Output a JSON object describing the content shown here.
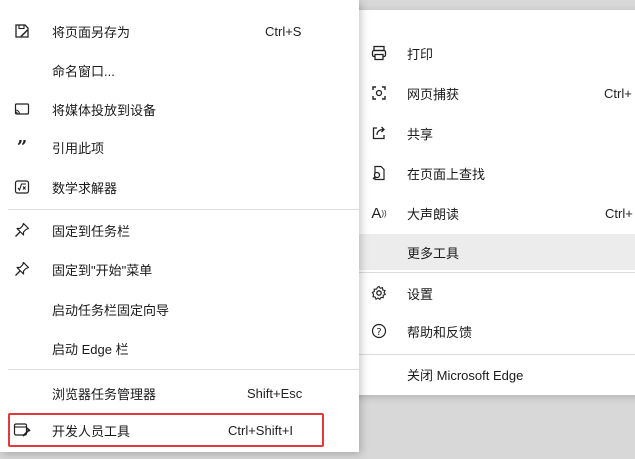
{
  "main_menu": {
    "items": [
      {
        "label": "打印",
        "icon": "printer-icon"
      },
      {
        "label": "网页捕获",
        "shortcut": "Ctrl+",
        "icon": "web-capture-icon"
      },
      {
        "label": "共享",
        "icon": "share-icon"
      },
      {
        "label": "在页面上查找",
        "icon": "find-on-page-icon"
      },
      {
        "label": "大声朗读",
        "shortcut": "Ctrl+",
        "icon": "read-aloud-icon"
      },
      {
        "label": "更多工具",
        "highlighted": true
      },
      {
        "label": "设置",
        "icon": "gear-icon"
      },
      {
        "label": "帮助和反馈",
        "icon": "help-icon"
      },
      {
        "label": "关闭 Microsoft Edge"
      }
    ]
  },
  "sub_menu": {
    "items": [
      {
        "label": "将页面另存为",
        "shortcut": "Ctrl+S",
        "icon": "save-page-icon"
      },
      {
        "label": "命名窗口..."
      },
      {
        "label": "将媒体投放到设备",
        "icon": "cast-icon"
      },
      {
        "label": "引用此项",
        "icon": "quote-icon"
      },
      {
        "label": "数学求解器",
        "icon": "math-solver-icon"
      },
      {
        "label": "固定到任务栏",
        "icon": "pin-icon"
      },
      {
        "label": "固定到\"开始\"菜单",
        "icon": "pin-icon"
      },
      {
        "label": "启动任务栏固定向导"
      },
      {
        "label": "启动 Edge 栏"
      },
      {
        "label": "浏览器任务管理器",
        "shortcut": "Shift+Esc"
      },
      {
        "label": "开发人员工具",
        "shortcut": "Ctrl+Shift+I",
        "icon": "developer-tools-icon",
        "highlight_color": "#e03a3a"
      }
    ]
  }
}
